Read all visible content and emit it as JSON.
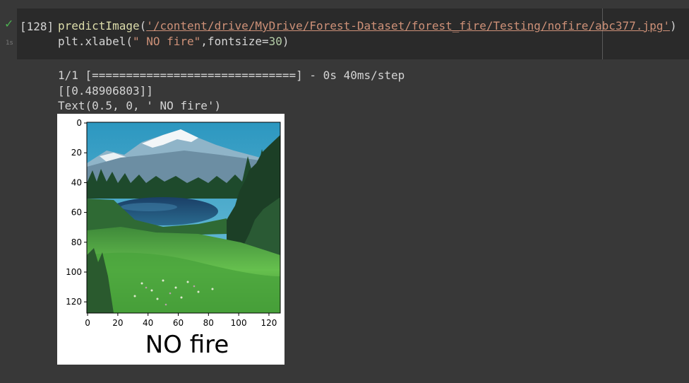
{
  "cell": {
    "status_icon": "check-icon",
    "duration": "1s",
    "execution_count": "[128]",
    "code": {
      "line1": {
        "fn": "predictImage",
        "open": "(",
        "path": "'/content/drive/MyDrive/Forest-Dataset/forest_fire/Testing/nofire/abc377.jpg'",
        "close": ")"
      },
      "line2": {
        "prefix": "plt.xlabel(",
        "label_str": "\" NO fire\"",
        "middle": ",fontsize=",
        "size": "30",
        "close": ")"
      }
    }
  },
  "output": {
    "progress": "1/1 [==============================] - 0s 40ms/step",
    "prediction": "[[0.48906803]]",
    "text_repr": "Text(0.5, 0, ' NO fire')"
  },
  "figure": {
    "xlabel": "NO fire",
    "y_ticks": [
      "0",
      "20",
      "40",
      "60",
      "80",
      "100",
      "120"
    ],
    "x_ticks": [
      "0",
      "20",
      "40",
      "60",
      "80",
      "100",
      "120"
    ],
    "image_content": "mountain-lake-forest-meadow",
    "colors": {
      "sky": "#3aa5c8",
      "snow": "#e8f0f4",
      "forest": "#1f4a2c",
      "lake": "#1d4f78",
      "meadow": "#5fb84a"
    }
  }
}
